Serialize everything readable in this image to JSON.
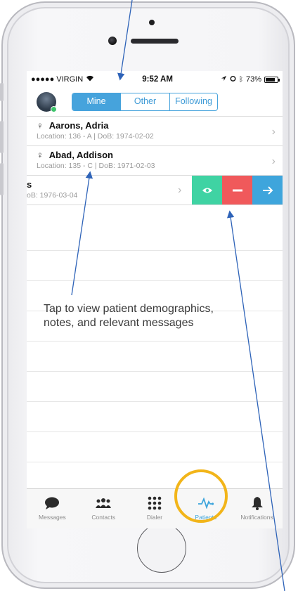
{
  "status_bar": {
    "carrier": "●●●●● VIRGIN",
    "time": "9:52 AM",
    "battery": "73%"
  },
  "segment": {
    "tabs": [
      "Mine",
      "Other",
      "Following"
    ],
    "selected": "Mine"
  },
  "patients": [
    {
      "gender": "♀",
      "name": "Aarons, Adria",
      "meta": "Location: 136 - A | DoB: 1974-02-02"
    },
    {
      "gender": "♀",
      "name": "Abad, Addison",
      "meta": "Location: 135 - C | DoB: 1971-02-03"
    }
  ],
  "swiped_row": {
    "name": "s",
    "meta": "oB: 1976-03-04"
  },
  "tabbar": {
    "items": [
      "Messages",
      "Contacts",
      "Dialer",
      "Patients",
      "Notifications"
    ],
    "active": "Patients"
  },
  "annotation": "Tap to view patient demographics, notes, and relevant messages",
  "colors": {
    "accent": "#46a3dc",
    "view": "#3fd3a3",
    "remove": "#f0595b",
    "forward": "#3ea5dc",
    "ring": "#f2b51a"
  }
}
